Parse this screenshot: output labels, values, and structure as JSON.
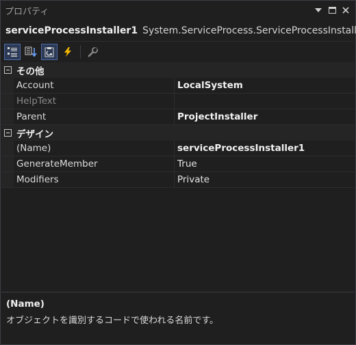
{
  "window": {
    "title": "プロパティ"
  },
  "colors": {
    "background": "#1f1f1f",
    "category_background": "#252526",
    "active_tool_border": "#4d6aa8",
    "lightning": "#f5b800"
  },
  "selector": {
    "object_name": "serviceProcessInstaller1",
    "object_type": "System.ServiceProcess.ServiceProcessInstaller"
  },
  "toolbar": {
    "buttons": [
      {
        "icon": "categorized-icon",
        "active": true
      },
      {
        "icon": "alphabetical-icon",
        "active": false
      },
      {
        "icon": "properties-icon",
        "active": true
      },
      {
        "icon": "events-lightning-icon",
        "active": false
      },
      {
        "icon": "property-pages-wrench-icon",
        "active": false
      }
    ]
  },
  "grid": {
    "categories": [
      {
        "label": "その他",
        "rows": [
          {
            "name": "Account",
            "value": "LocalSystem"
          },
          {
            "name": "HelpText",
            "value": ""
          },
          {
            "name": "Parent",
            "value": "ProjectInstaller"
          }
        ]
      },
      {
        "label": "デザイン",
        "rows": [
          {
            "name": "(Name)",
            "value": "serviceProcessInstaller1"
          },
          {
            "name": "GenerateMember",
            "value": "True"
          },
          {
            "name": "Modifiers",
            "value": "Private"
          }
        ]
      }
    ]
  },
  "description": {
    "title": "(Name)",
    "text": "オブジェクトを識別するコードで使われる名前です。"
  }
}
